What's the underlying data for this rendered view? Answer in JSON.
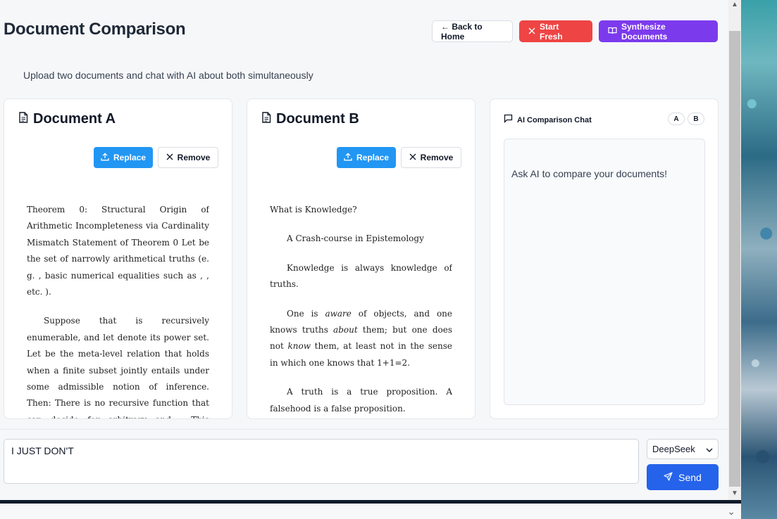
{
  "header": {
    "title": "Document Comparison",
    "subtitle": "Upload two documents and chat with AI about both simultaneously",
    "back_label": "← Back to Home",
    "start_fresh_label": "Start Fresh",
    "synthesize_label": "Synthesize Documents"
  },
  "document_a": {
    "title": "Document A",
    "replace_label": "Replace",
    "remove_label": "Remove",
    "paragraphs": [
      "Theorem 0: Structural Origin of Arithmetic Incompleteness via Cardinality Mismatch Statement of Theorem 0 Let be the set of narrowly arithmetical truths (e. g. , basic numerical equalities such as , , etc. ).",
      "Suppose that is recursively enumerable, and let denote its power set. Let be the meta-level relation that holds when a finite subset jointly entails under some admissible notion of inference. Then: There is no recursive function that can decide for arbitrary and . This structural limitation implies that any recursively axiomatizable system attempting to"
    ]
  },
  "document_b": {
    "title": "Document B",
    "replace_label": "Replace",
    "remove_label": "Remove",
    "heading": "What is Knowledge?",
    "p1": "A Crash-course in Epistemology",
    "p2": "Knowledge is always knowledge of truths.",
    "p3_a": "One is ",
    "p3_em1": "aware",
    "p3_b": " of objects, and one knows truths ",
    "p3_em2": "about",
    "p3_c": " them; but one does not ",
    "p3_em3": "know",
    "p3_d": " them, at least not in the sense in which one knows that 1+1=2.",
    "p4": "A truth is a true proposition. A falsehood is a false proposition."
  },
  "chat": {
    "title": "AI Comparison Chat",
    "chip_a": "A",
    "chip_b": "B",
    "empty_message": "Ask AI to compare your documents!"
  },
  "composer": {
    "input_value": "I JUST DON'T",
    "model_selected": "DeepSeek",
    "send_label": "Send"
  },
  "colors": {
    "accent_blue": "#2196f3",
    "send_blue": "#2563eb",
    "danger": "#ef4444",
    "purple": "#7c3aed"
  }
}
